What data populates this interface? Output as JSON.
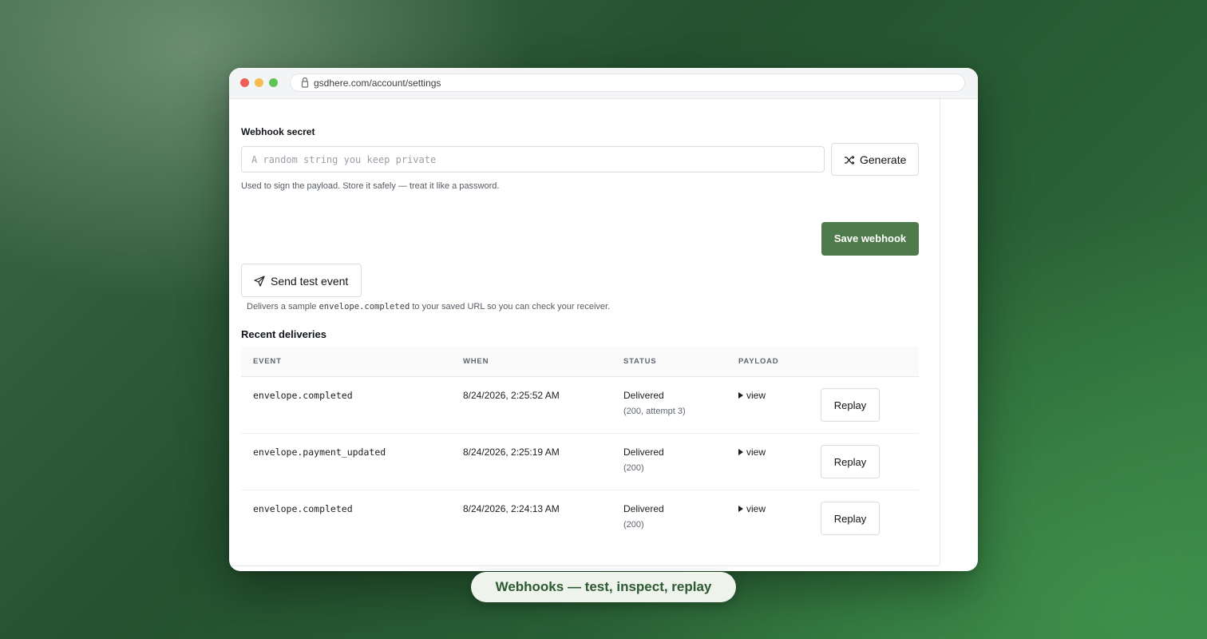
{
  "browser": {
    "url": "gsdhere.com/account/settings",
    "icons": {
      "lock": "lock-icon"
    }
  },
  "webhook": {
    "secret_label": "Webhook secret",
    "secret_placeholder": "A random string you keep private",
    "secret_value": "",
    "generate_label": "Generate",
    "generate_icon": "shuffle-icon",
    "secret_hint": "Used to sign the payload. Store it safely — treat it like a password.",
    "save_label": "Save webhook",
    "save_color": "#4f7a4b"
  },
  "test": {
    "button_label": "Send test event",
    "button_icon": "send-icon",
    "hint_prefix": "Delivers a sample",
    "hint_code": "envelope.completed",
    "hint_suffix": "to your saved URL so you can check your receiver."
  },
  "deliveries": {
    "title": "Recent deliveries",
    "columns": [
      "EVENT",
      "WHEN",
      "STATUS",
      "PAYLOAD"
    ],
    "rows": [
      {
        "event": "envelope.completed",
        "when": "8/24/2026, 2:25:52 AM",
        "status": "Delivered",
        "detail": "(200, attempt 3)",
        "payload": "view",
        "action": "Replay"
      },
      {
        "event": "envelope.payment_updated",
        "when": "8/24/2026, 2:25:19 AM",
        "status": "Delivered",
        "detail": "(200)",
        "payload": "view",
        "action": "Replay"
      },
      {
        "event": "envelope.completed",
        "when": "8/24/2026, 2:24:13 AM",
        "status": "Delivered",
        "detail": "(200)",
        "payload": "view",
        "action": "Replay"
      }
    ]
  },
  "caption": "Webhooks — test, inspect, replay",
  "colors": {
    "accent": "#4f7a4b",
    "caption_text": "#2e5a33",
    "background_green": "#2a6236"
  }
}
